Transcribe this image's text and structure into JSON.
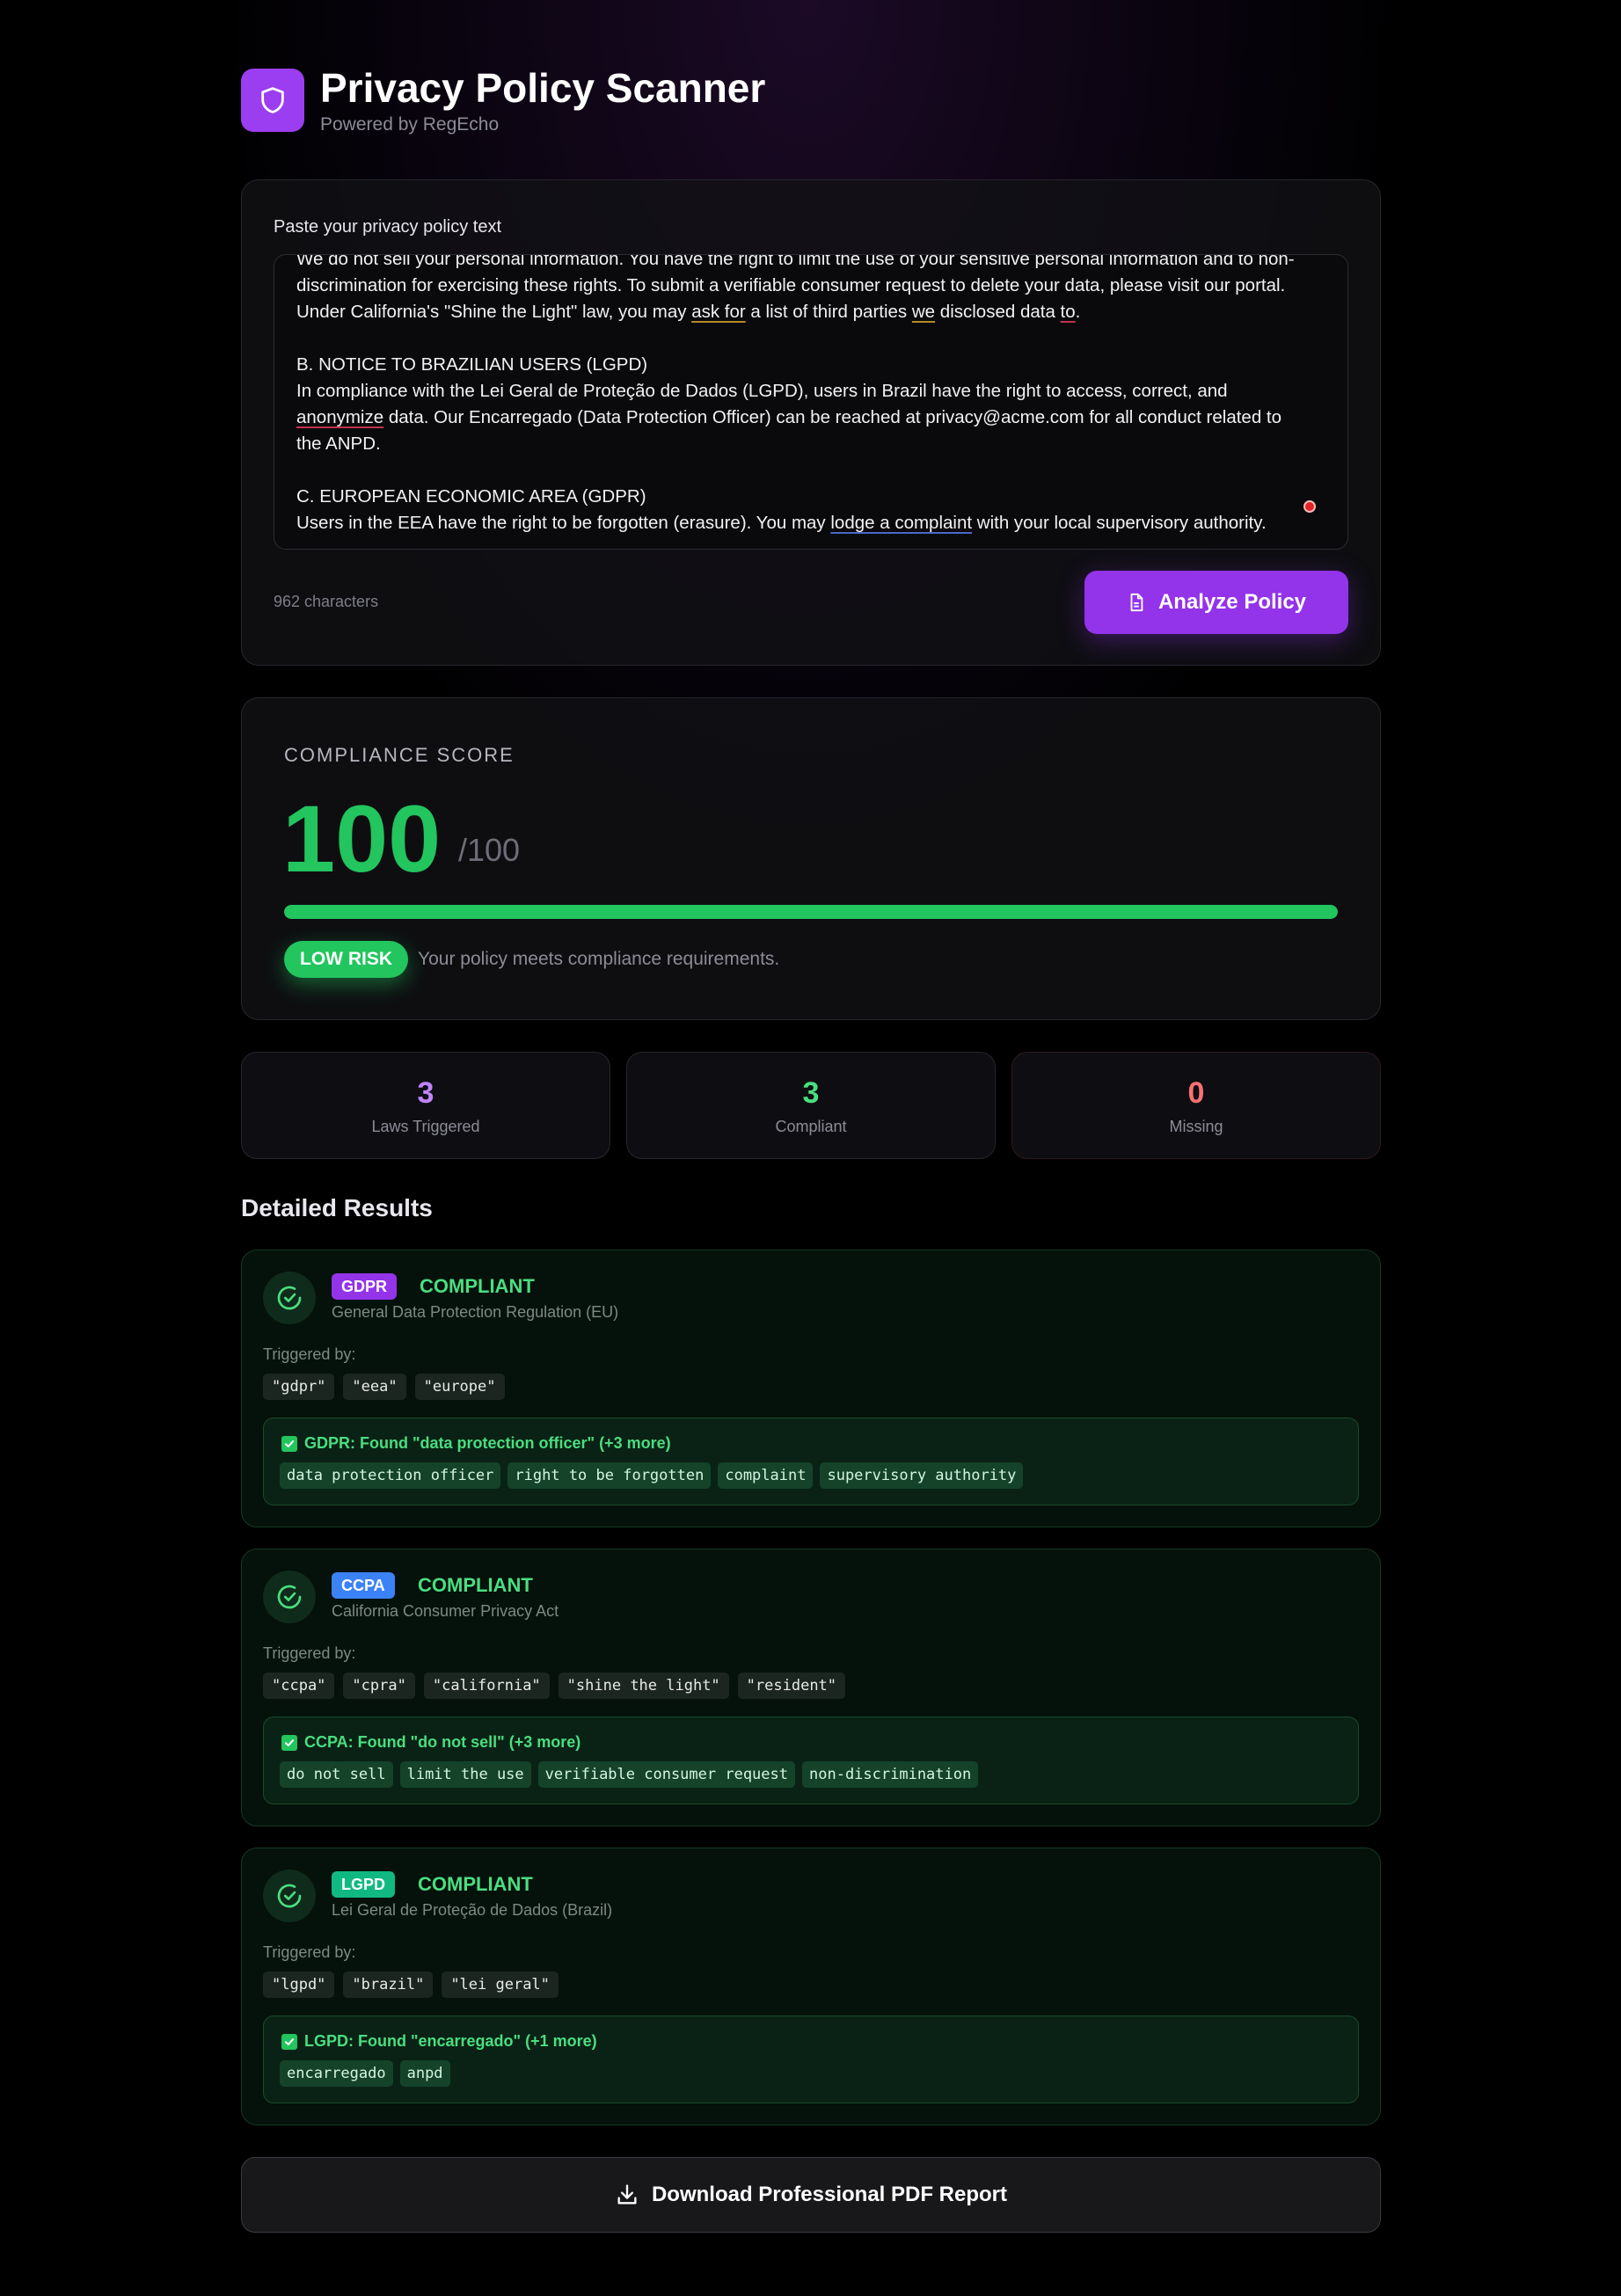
{
  "header": {
    "title": "Privacy Policy Scanner",
    "subtitle": "Powered by RegEcho",
    "logo_icon": "shield-icon"
  },
  "input": {
    "label": "Paste your privacy policy text",
    "lines": {
      "l0": "We do not sell your personal information. You have the right to limit the use of your sensitive personal information and to non-",
      "l1": "discrimination for exercising these rights. To submit a verifiable consumer request to delete your data, please visit our portal.",
      "l2a": "Under California's \"Shine the Light\" law, you may ",
      "l2b": "ask for",
      "l2c": " a list of third parties ",
      "l2d": "we",
      "l2e": " disclosed data ",
      "l2f": "to",
      "l2g": ".",
      "l3": "B. NOTICE TO BRAZILIAN USERS (LGPD)",
      "l4": "In compliance with the Lei Geral de Proteção de Dados (LGPD), users in Brazil have the right to access, correct, and",
      "l5a": "anonymize",
      "l5b": " data. Our Encarregado (Data Protection Officer) can be reached at privacy@acme.com for all conduct related to",
      "l6": "the ANPD.",
      "l7": "C. EUROPEAN ECONOMIC AREA (GDPR)",
      "l8a": "Users in the EEA have the right to be forgotten (erasure). You may ",
      "l8b": "lodge a complaint",
      "l8c": " with your local supervisory authority."
    },
    "char_count": "962 characters",
    "analyze_label": "Analyze Policy"
  },
  "score": {
    "label": "COMPLIANCE SCORE",
    "value": "100",
    "max": "/100",
    "progress_percent": 100,
    "risk_badge": "LOW RISK",
    "risk_message": "Your policy meets compliance requirements.",
    "bar_color": "#22c55e"
  },
  "stats": [
    {
      "value": "3",
      "label": "Laws Triggered",
      "color": "#c084fc"
    },
    {
      "value": "3",
      "label": "Compliant",
      "color": "#4ade80"
    },
    {
      "value": "0",
      "label": "Missing",
      "color": "#f87171"
    }
  ],
  "results_title": "Detailed Results",
  "results": [
    {
      "tag": "GDPR",
      "tag_color": "#9333ea",
      "status": "COMPLIANT",
      "name": "General Data Protection Regulation (EU)",
      "triggered_label": "Triggered by:",
      "triggers": [
        "\"gdpr\"",
        "\"eea\"",
        "\"europe\""
      ],
      "found": "GDPR: Found \"data protection officer\" (+3 more)",
      "keywords": [
        "data protection officer",
        "right to be forgotten",
        "complaint",
        "supervisory authority"
      ]
    },
    {
      "tag": "CCPA",
      "tag_color": "#3b82f6",
      "status": "COMPLIANT",
      "name": "California Consumer Privacy Act",
      "triggered_label": "Triggered by:",
      "triggers": [
        "\"ccpa\"",
        "\"cpra\"",
        "\"california\"",
        "\"shine the light\"",
        "\"resident\""
      ],
      "found": "CCPA: Found \"do not sell\" (+3 more)",
      "keywords": [
        "do not sell",
        "limit the use",
        "verifiable consumer request",
        "non-discrimination"
      ]
    },
    {
      "tag": "LGPD",
      "tag_color": "#10b981",
      "status": "COMPLIANT",
      "name": "Lei Geral de Proteção de Dados (Brazil)",
      "triggered_label": "Triggered by:",
      "triggers": [
        "\"lgpd\"",
        "\"brazil\"",
        "\"lei geral\""
      ],
      "found": "LGPD: Found \"encarregado\" (+1 more)",
      "keywords": [
        "encarregado",
        "anpd"
      ]
    }
  ],
  "download_label": "Download Professional PDF Report"
}
